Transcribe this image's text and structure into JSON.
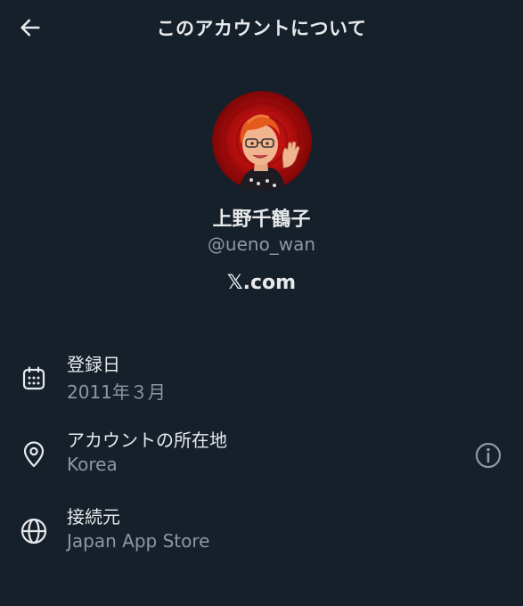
{
  "header": {
    "title": "このアカウントについて",
    "back_icon": "arrow-left-icon"
  },
  "profile": {
    "display_name": "上野千鶴子",
    "handle": "@ueno_wan",
    "platform": "𝕏.com",
    "avatar_icon": "avatar-cartoon"
  },
  "details": [
    {
      "icon": "calendar-icon",
      "label": "登録日",
      "value": "2011年３月"
    },
    {
      "icon": "location-pin-icon",
      "label": "アカウントの所在地",
      "value": "Korea",
      "trailing_icon": "info-icon"
    },
    {
      "icon": "globe-icon",
      "label": "接続元",
      "value": "Japan App Store"
    }
  ],
  "colors": {
    "background": "#16202b",
    "primary_text": "#e7e9ea",
    "secondary_text": "#8b98a5"
  }
}
